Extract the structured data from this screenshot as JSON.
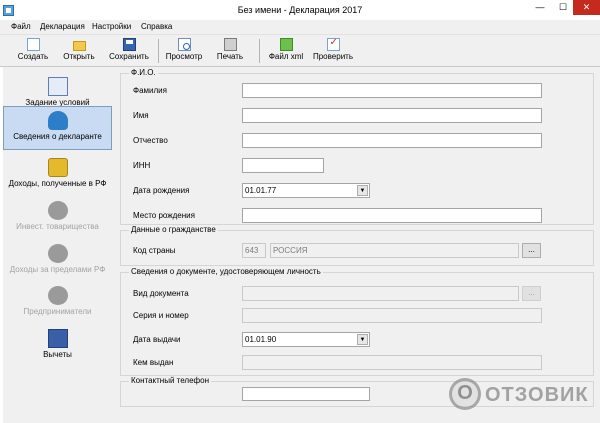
{
  "window": {
    "title": "Без имени - Декларация 2017",
    "minimize_glyph": "—",
    "maximize_glyph": "☐",
    "close_glyph": "✕"
  },
  "menu": [
    "Файл",
    "Декларация",
    "Настройки",
    "Справка"
  ],
  "toolbar": {
    "create": "Создать",
    "open": "Открыть",
    "save": "Сохранить",
    "preview": "Просмотр",
    "print": "Печать",
    "xml": "Файл xml",
    "check": "Проверить"
  },
  "sidebar": {
    "items": [
      {
        "label": "Задание условий",
        "icon": "tree-icon",
        "state": "normal"
      },
      {
        "label": "Сведения о декларанте",
        "icon": "person-icon",
        "state": "selected"
      },
      {
        "label": "Доходы, полученные в РФ",
        "icon": "coins-icon",
        "state": "normal"
      },
      {
        "label": "Инвест. товарищества",
        "icon": "investor-icon",
        "state": "disabled"
      },
      {
        "label": "Доходы за пределами РФ",
        "icon": "money-bag-icon",
        "state": "disabled"
      },
      {
        "label": "Предприниматели",
        "icon": "entrepreneur-icon",
        "state": "disabled"
      },
      {
        "label": "Вычеты",
        "icon": "calculator-icon",
        "state": "normal"
      }
    ]
  },
  "fio": {
    "group_title": "Ф.И.О.",
    "surname_label": "Фамилия",
    "surname_value": "",
    "name_label": "Имя",
    "name_value": "",
    "patronymic_label": "Отчество",
    "patronymic_value": "",
    "inn_label": "ИНН",
    "inn_value": "",
    "birth_date_label": "Дата рождения",
    "birth_date_value": "01.01.77",
    "birth_place_label": "Место рождения",
    "birth_place_value": ""
  },
  "citizenship": {
    "group_title": "Данные о гражданстве",
    "country_label": "Код страны",
    "country_code": "643",
    "country_name": "РОССИЯ",
    "browse_label": "..."
  },
  "identity": {
    "group_title": "Сведения о документе, удостоверяющем личность",
    "doc_type_label": "Вид документа",
    "doc_type_value": "",
    "browse_label": "...",
    "series_label": "Серия и номер",
    "series_value": "",
    "issue_date_label": "Дата выдачи",
    "issue_date_value": "01.01.90",
    "issued_by_label": "Кем выдан",
    "issued_by_value": ""
  },
  "contact": {
    "group_title": "Контактный телефон",
    "phone_value": ""
  },
  "watermark": {
    "letter": "О",
    "text": "ОТЗОВИК"
  }
}
